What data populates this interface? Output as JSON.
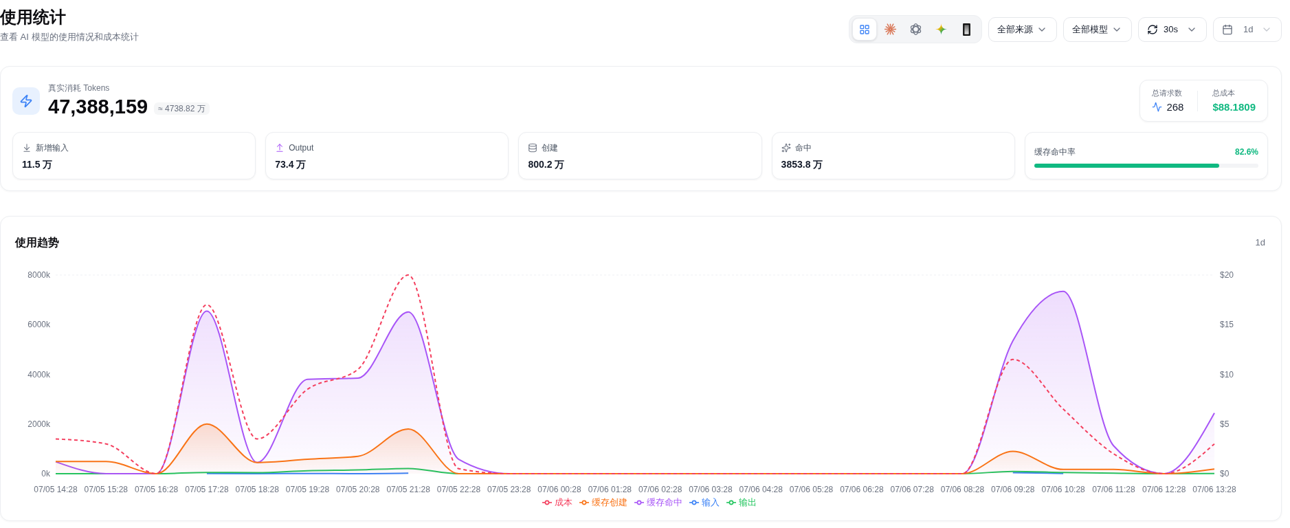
{
  "header": {
    "title": "使用统计",
    "subtitle": "查看 AI 模型的使用情况和成本统计"
  },
  "source_tabs": [
    {
      "kind": "grid",
      "selected": true
    },
    {
      "kind": "starburst",
      "selected": false
    },
    {
      "kind": "knot",
      "selected": false
    },
    {
      "kind": "sparkle",
      "selected": false
    },
    {
      "kind": "tile",
      "selected": false
    }
  ],
  "dropdowns": [
    {
      "kind": "select",
      "value": "全部来源",
      "disabled": false
    },
    {
      "kind": "select",
      "value": "全部模型",
      "disabled": false
    },
    {
      "kind": "refresh",
      "value": "30s",
      "disabled": false
    },
    {
      "kind": "calendar",
      "value": "1d",
      "disabled": true
    }
  ],
  "summary": {
    "label": "真实消耗 Tokens",
    "total": "47,388,159",
    "approx": "≈ 4738.82 万",
    "requests": {
      "label": "总请求数",
      "value": "268"
    },
    "cost": {
      "label": "总成本",
      "value": "$88.1809"
    }
  },
  "metrics": [
    {
      "kind": "input",
      "label": "新增输入",
      "value": "11.5 万"
    },
    {
      "kind": "output",
      "label": "Output",
      "value": "73.4 万"
    },
    {
      "kind": "create",
      "label": "创建",
      "value": "800.2 万"
    },
    {
      "kind": "hit",
      "label": "命中",
      "value": "3853.8 万"
    }
  ],
  "hit_rate": {
    "label": "缓存命中率",
    "reading": "82.6%",
    "level": 0.826
  },
  "trend": {
    "title": "使用趋势",
    "range": "1d",
    "chart_data": {
      "type": "area",
      "categories": [
        "07/05 14:28",
        "07/05 15:28",
        "07/05 16:28",
        "07/05 17:28",
        "07/05 18:28",
        "07/05 19:28",
        "07/05 20:28",
        "07/05 21:28",
        "07/05 22:28",
        "07/05 23:28",
        "07/06 00:28",
        "07/06 01:28",
        "07/06 02:28",
        "07/06 03:28",
        "07/06 04:28",
        "07/06 05:28",
        "07/06 06:28",
        "07/06 07:28",
        "07/06 08:28",
        "07/06 09:28",
        "07/06 10:28",
        "07/06 11:28",
        "07/06 12:28",
        "07/06 13:28"
      ],
      "ylim": [
        0,
        8000
      ],
      "yticks": [
        {
          "value": 0,
          "label": "0k"
        },
        {
          "value": 2000,
          "label": "2000k"
        },
        {
          "value": 4000,
          "label": "4000k"
        },
        {
          "value": 6000,
          "label": "6000k"
        },
        {
          "value": 8000,
          "label": "8000k"
        }
      ],
      "y2lim": [
        0,
        20
      ],
      "y2ticks": [
        {
          "value": 0,
          "label": "$0"
        },
        {
          "value": 5,
          "label": "$5"
        },
        {
          "value": 10,
          "label": "$10"
        },
        {
          "value": 15,
          "label": "$15"
        },
        {
          "value": 20,
          "label": "$20"
        }
      ],
      "series": [
        {
          "name": "成本",
          "color": "#f43f5e",
          "axis": "y2",
          "type": "line",
          "line_style": "dashed",
          "values": [
            3.5,
            3,
            0,
            17,
            3.5,
            8.5,
            10.5,
            20,
            0.5,
            0,
            0,
            0,
            0,
            0,
            0,
            0,
            0,
            0,
            0,
            11.5,
            6.5,
            2,
            0,
            3
          ]
        },
        {
          "name": "缓存创建",
          "color": "#f97316",
          "values": [
            490,
            490,
            0,
            2000,
            450,
            580,
            700,
            1800,
            0,
            0,
            0,
            0,
            0,
            0,
            0,
            0,
            0,
            0,
            0,
            900,
            170,
            170,
            0,
            190
          ]
        },
        {
          "name": "缓存命中",
          "color": "#a855f7",
          "values": [
            480,
            0,
            0,
            6550,
            450,
            3800,
            3850,
            6510,
            580,
            0,
            0,
            0,
            0,
            0,
            0,
            0,
            0,
            0,
            0,
            5350,
            7340,
            1120,
            0,
            2440
          ]
        },
        {
          "name": "输入",
          "color": "#3b82f6",
          "type": "line",
          "values": [
            null,
            null,
            null,
            10,
            0,
            10,
            0,
            20,
            null,
            null,
            null,
            null,
            null,
            null,
            null,
            null,
            null,
            null,
            null,
            40,
            10,
            null,
            null,
            null
          ]
        },
        {
          "name": "输出",
          "color": "#22c55e",
          "type": "line",
          "values": [
            0,
            0,
            0,
            50,
            40,
            120,
            150,
            210,
            0,
            0,
            0,
            0,
            0,
            0,
            0,
            0,
            0,
            0,
            0,
            90,
            50,
            20,
            0,
            10
          ]
        }
      ]
    }
  }
}
